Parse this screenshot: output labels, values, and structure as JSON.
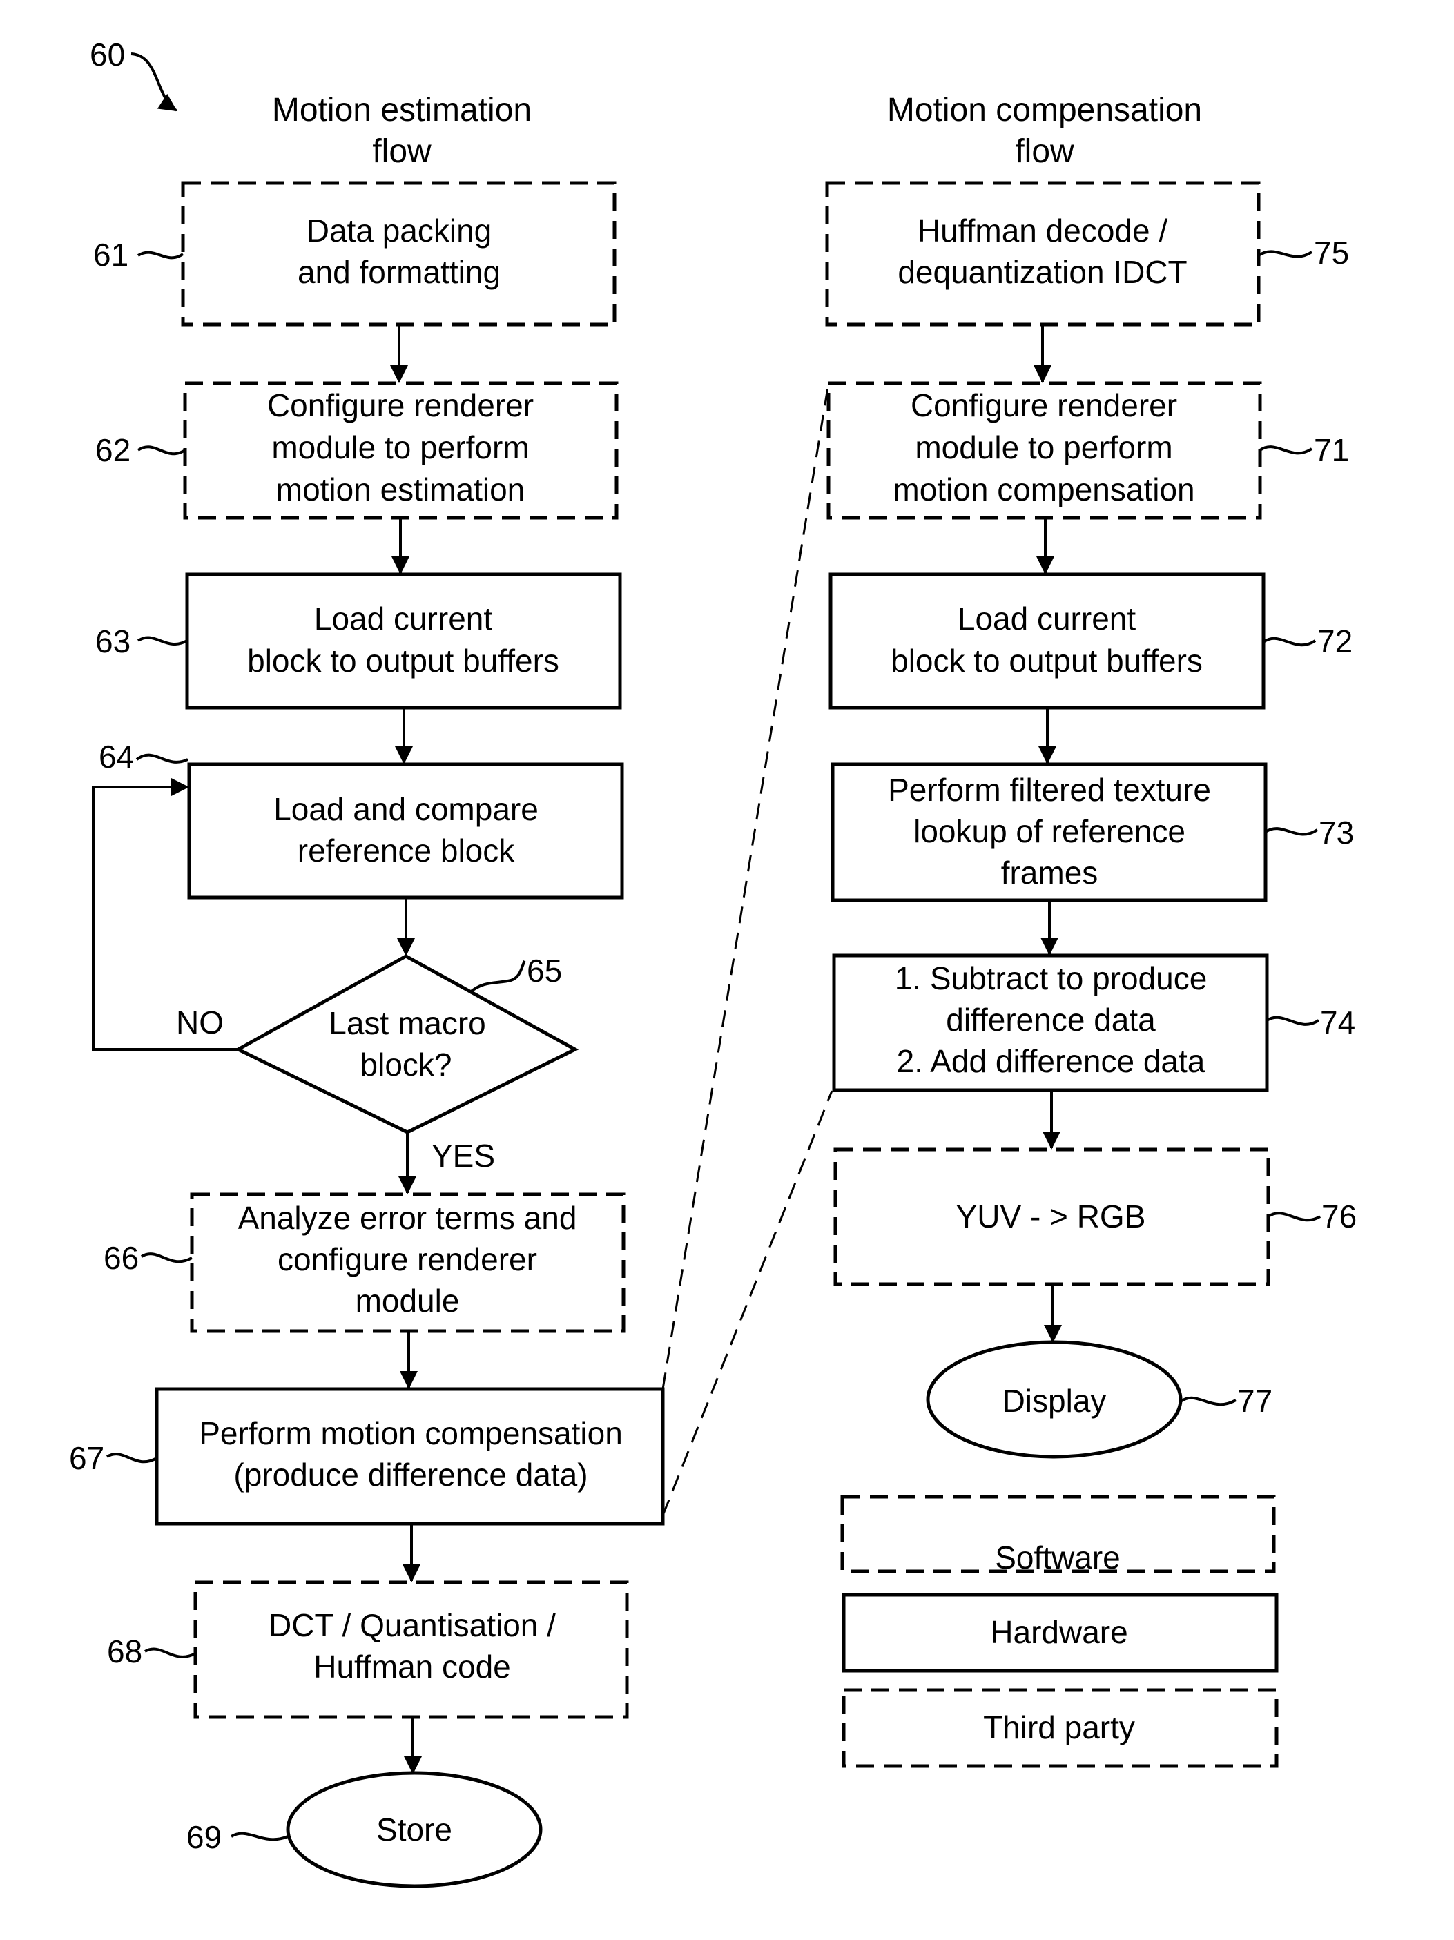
{
  "figure_ref": "60",
  "left_flow": {
    "title_line1": "Motion estimation",
    "title_line2": "flow",
    "steps": [
      {
        "ref": "61",
        "type": "software",
        "lines": [
          "Data packing",
          "and formatting"
        ]
      },
      {
        "ref": "62",
        "type": "software",
        "lines": [
          "Configure renderer",
          "module to perform",
          "motion estimation"
        ]
      },
      {
        "ref": "63",
        "type": "hardware",
        "lines": [
          "Load current",
          "block to output buffers"
        ]
      },
      {
        "ref": "64",
        "type": "hardware",
        "lines": [
          "Load and compare",
          "reference block"
        ]
      },
      {
        "ref": "65",
        "type": "decision",
        "lines": [
          "Last macro",
          "block?"
        ],
        "no_label": "NO",
        "yes_label": "YES"
      },
      {
        "ref": "66",
        "type": "software",
        "lines": [
          "Analyze error terms and",
          "configure renderer",
          "module"
        ]
      },
      {
        "ref": "67",
        "type": "hardware",
        "lines": [
          "Perform motion compensation",
          "(produce difference data)"
        ]
      },
      {
        "ref": "68",
        "type": "software",
        "lines": [
          "DCT / Quantisation /",
          "Huffman code"
        ]
      },
      {
        "ref": "69",
        "type": "terminal",
        "lines": [
          "Store"
        ]
      }
    ]
  },
  "right_flow": {
    "title_line1": "Motion compensation",
    "title_line2": "flow",
    "steps": [
      {
        "ref": "75",
        "type": "software",
        "lines": [
          "Huffman decode /",
          "dequantization IDCT"
        ]
      },
      {
        "ref": "71",
        "type": "software",
        "lines": [
          "Configure renderer",
          "module to perform",
          "motion compensation"
        ]
      },
      {
        "ref": "72",
        "type": "hardware",
        "lines": [
          "Load current",
          "block to output buffers"
        ]
      },
      {
        "ref": "73",
        "type": "hardware",
        "lines": [
          "Perform filtered texture",
          "lookup of reference",
          "frames"
        ]
      },
      {
        "ref": "74",
        "type": "hardware",
        "lines": [
          "1. Subtract to produce",
          "difference data",
          "2. Add difference data"
        ]
      },
      {
        "ref": "76",
        "type": "third-party",
        "lines": [
          "YUV - > RGB"
        ]
      },
      {
        "ref": "77",
        "type": "terminal",
        "lines": [
          "Display"
        ]
      }
    ]
  },
  "legend": [
    {
      "type": "software",
      "label": "Software"
    },
    {
      "type": "hardware",
      "label": "Hardware"
    },
    {
      "type": "third-party",
      "label": "Third party"
    }
  ]
}
